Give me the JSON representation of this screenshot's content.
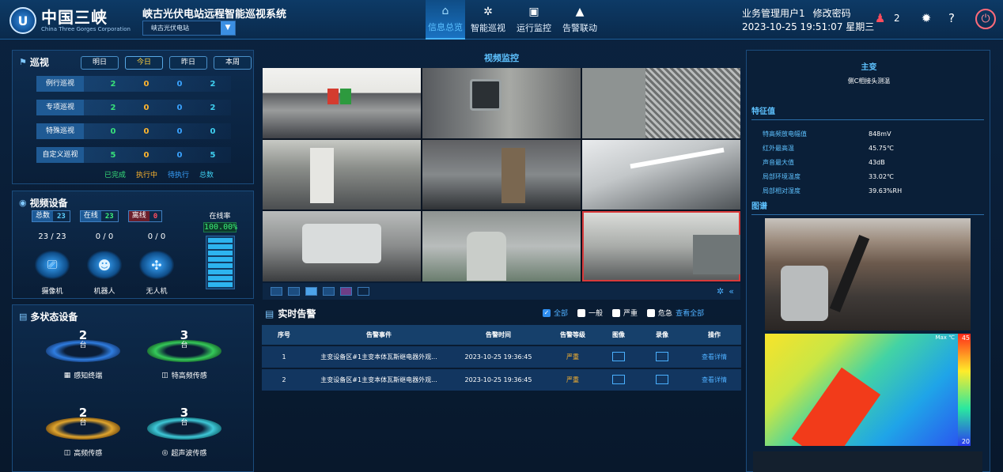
{
  "header": {
    "logo_mark": "U",
    "logo_cn": "中国三峡",
    "logo_en": "China Three Gorges Corporation",
    "system_title": "峡古光伏电站远程智能巡视系统",
    "station_select": "峡古光伏电站",
    "nav": [
      {
        "label": "信息总览",
        "icon": "home-icon",
        "active": true
      },
      {
        "label": "智能巡视",
        "icon": "gear-icon",
        "active": false
      },
      {
        "label": "运行监控",
        "icon": "monitor-icon",
        "active": false
      },
      {
        "label": "告警联动",
        "icon": "warning-icon",
        "active": false
      }
    ],
    "user": "业务管理用户1",
    "change_password": "修改密码",
    "datetime": "2023-10-25 19:51:07 星期三",
    "alarm_count": "2"
  },
  "patrol": {
    "title": "巡视",
    "tabs": [
      "明日",
      "今日",
      "昨日",
      "本周"
    ],
    "selected_tab": "今日",
    "rows": [
      {
        "label": "例行巡视",
        "done": "2",
        "running": "0",
        "waiting": "0",
        "total": "2"
      },
      {
        "label": "专项巡视",
        "done": "2",
        "running": "0",
        "waiting": "0",
        "total": "2"
      },
      {
        "label": "特殊巡视",
        "done": "0",
        "running": "0",
        "waiting": "0",
        "total": "0"
      },
      {
        "label": "自定义巡视",
        "done": "5",
        "running": "0",
        "waiting": "0",
        "total": "5"
      }
    ],
    "legend": {
      "done": "已完成",
      "running": "执行中",
      "waiting": "待执行",
      "total": "总数"
    }
  },
  "video_devices": {
    "title": "视频设备",
    "total_label": "总数",
    "total": "23",
    "online_label": "在线",
    "online": "23",
    "offline_label": "离线",
    "offline": "0",
    "rate_label": "在线率",
    "rate": "100.00%",
    "rate_fraction": 1.0,
    "devices": [
      {
        "name": "摄像机",
        "count": "23 / 23"
      },
      {
        "name": "机器人",
        "count": "0 / 0"
      },
      {
        "name": "无人机",
        "count": "0 / 0"
      }
    ]
  },
  "multi_devices": {
    "title": "多状态设备",
    "items": [
      {
        "name": "感知终端",
        "count": "2",
        "unit": "台",
        "color": "#2f7de0"
      },
      {
        "name": "特高频传感",
        "count": "3",
        "unit": "台",
        "color": "#35c95a"
      },
      {
        "name": "高频传感",
        "count": "2",
        "unit": "台",
        "color": "#e0a52f"
      },
      {
        "name": "超声波传感",
        "count": "3",
        "unit": "台",
        "color": "#3fc8d8"
      }
    ]
  },
  "monitor": {
    "title": "视频监控",
    "selected_cell": 8
  },
  "alarms": {
    "title": "实时告警",
    "filters": [
      {
        "label": "全部",
        "checked": true
      },
      {
        "label": "一般",
        "checked": false
      },
      {
        "label": "严重",
        "checked": false
      },
      {
        "label": "危急",
        "checked": false
      }
    ],
    "view_all": "查看全部",
    "columns": [
      "序号",
      "告警事件",
      "告警时间",
      "告警等级",
      "图像",
      "录像",
      "操作"
    ],
    "rows": [
      {
        "no": "1",
        "event": "主变设备区#1主变本体瓦斯继电器外观...",
        "time": "2023-10-25 19:36:45",
        "level": "严重",
        "action": "查看详情"
      },
      {
        "no": "2",
        "event": "主变设备区#1主变本体瓦斯继电器外观...",
        "time": "2023-10-25 19:36:45",
        "level": "严重",
        "action": "查看详情"
      }
    ]
  },
  "detail": {
    "title": "主变",
    "subtitle": "侧C相接头测温",
    "feature_title": "特征值",
    "features": [
      {
        "k": "特高频放电幅值",
        "v": "848mV"
      },
      {
        "k": "红外最高温",
        "v": "45.75℃"
      },
      {
        "k": "声音最大值",
        "v": "43dB"
      },
      {
        "k": "局部环境温度",
        "v": "33.02℃"
      },
      {
        "k": "局部相对湿度",
        "v": "39.63%RH"
      }
    ],
    "image_title": "图谱",
    "thermal_max": "45",
    "thermal_min": "20",
    "thermal_label": "Max ℃"
  }
}
